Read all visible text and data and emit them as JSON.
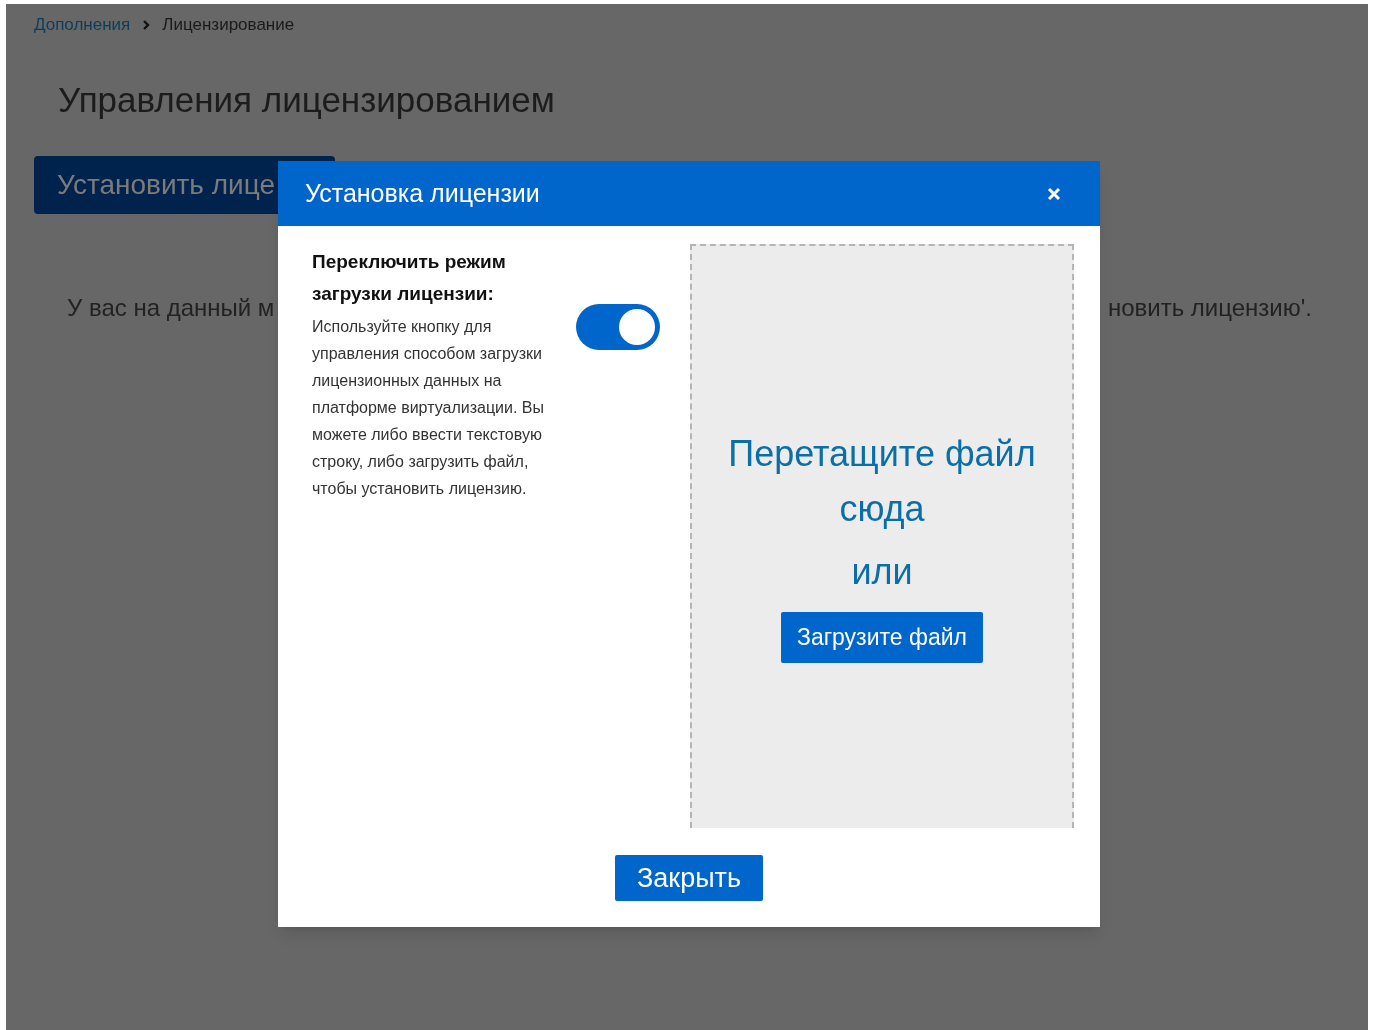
{
  "breadcrumb": [
    {
      "label": "Дополнения",
      "kind": "link"
    },
    {
      "label": "Лицензирование",
      "kind": "current"
    }
  ],
  "page_title": "Управления лицензированием",
  "install_button": "Установить лице",
  "notice": {
    "left": "У вас на данный м",
    "right": "новить лицензию'."
  },
  "dialog": {
    "title": "Установка лицензии",
    "toggle": {
      "heading": "Переключить режим загрузки лицензии:",
      "description": "Используйте кнопку для управления способом загрузки лицензионных данных на платформе виртуализации. Вы можете либо ввести текстовую строку, либо загрузить файл, чтобы установить лицензию.",
      "on": true
    },
    "dropzone": {
      "prompt": "Перетащите файл сюда",
      "or": "или",
      "upload_button": "Загрузите файл"
    },
    "close_button": "Закрыть"
  }
}
